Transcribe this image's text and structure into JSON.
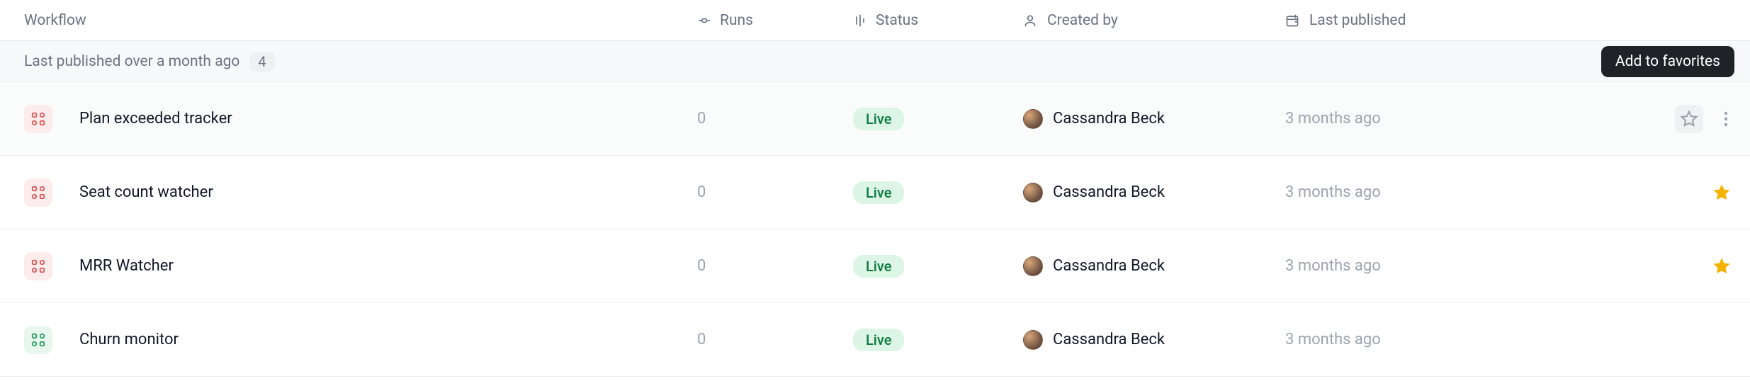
{
  "columns": {
    "workflow": "Workflow",
    "runs": "Runs",
    "status": "Status",
    "created_by": "Created by",
    "last_published": "Last published"
  },
  "group": {
    "label": "Last published over a month ago",
    "count": "4"
  },
  "tooltip": {
    "add_fav": "Add to favorites"
  },
  "rows": [
    {
      "name": "Plan exceeded tracker",
      "icon_color": "red",
      "runs": "0",
      "status": "Live",
      "creator": "Cassandra Beck",
      "last_published": "3 months ago",
      "favorited": false,
      "hovered": true
    },
    {
      "name": "Seat count watcher",
      "icon_color": "red",
      "runs": "0",
      "status": "Live",
      "creator": "Cassandra Beck",
      "last_published": "3 months ago",
      "favorited": true,
      "hovered": false
    },
    {
      "name": "MRR Watcher",
      "icon_color": "red",
      "runs": "0",
      "status": "Live",
      "creator": "Cassandra Beck",
      "last_published": "3 months ago",
      "favorited": true,
      "hovered": false
    },
    {
      "name": "Churn monitor",
      "icon_color": "green",
      "runs": "0",
      "status": "Live",
      "creator": "Cassandra Beck",
      "last_published": "3 months ago",
      "favorited": false,
      "hovered": false
    }
  ]
}
